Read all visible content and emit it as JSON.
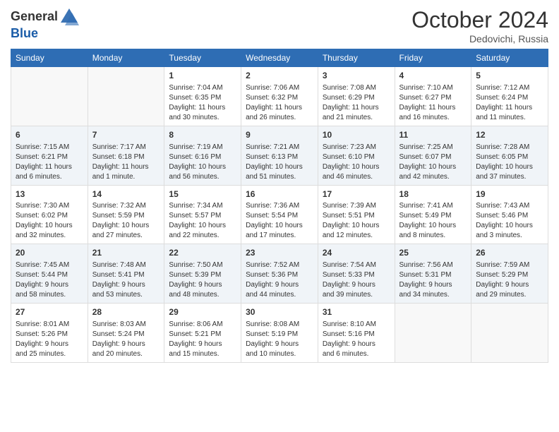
{
  "header": {
    "logo_general": "General",
    "logo_blue": "Blue",
    "month": "October 2024",
    "location": "Dedovichi, Russia"
  },
  "weekdays": [
    "Sunday",
    "Monday",
    "Tuesday",
    "Wednesday",
    "Thursday",
    "Friday",
    "Saturday"
  ],
  "weeks": [
    [
      {
        "day": "",
        "content": ""
      },
      {
        "day": "",
        "content": ""
      },
      {
        "day": "1",
        "content": "Sunrise: 7:04 AM\nSunset: 6:35 PM\nDaylight: 11 hours\nand 30 minutes."
      },
      {
        "day": "2",
        "content": "Sunrise: 7:06 AM\nSunset: 6:32 PM\nDaylight: 11 hours\nand 26 minutes."
      },
      {
        "day": "3",
        "content": "Sunrise: 7:08 AM\nSunset: 6:29 PM\nDaylight: 11 hours\nand 21 minutes."
      },
      {
        "day": "4",
        "content": "Sunrise: 7:10 AM\nSunset: 6:27 PM\nDaylight: 11 hours\nand 16 minutes."
      },
      {
        "day": "5",
        "content": "Sunrise: 7:12 AM\nSunset: 6:24 PM\nDaylight: 11 hours\nand 11 minutes."
      }
    ],
    [
      {
        "day": "6",
        "content": "Sunrise: 7:15 AM\nSunset: 6:21 PM\nDaylight: 11 hours\nand 6 minutes."
      },
      {
        "day": "7",
        "content": "Sunrise: 7:17 AM\nSunset: 6:18 PM\nDaylight: 11 hours\nand 1 minute."
      },
      {
        "day": "8",
        "content": "Sunrise: 7:19 AM\nSunset: 6:16 PM\nDaylight: 10 hours\nand 56 minutes."
      },
      {
        "day": "9",
        "content": "Sunrise: 7:21 AM\nSunset: 6:13 PM\nDaylight: 10 hours\nand 51 minutes."
      },
      {
        "day": "10",
        "content": "Sunrise: 7:23 AM\nSunset: 6:10 PM\nDaylight: 10 hours\nand 46 minutes."
      },
      {
        "day": "11",
        "content": "Sunrise: 7:25 AM\nSunset: 6:07 PM\nDaylight: 10 hours\nand 42 minutes."
      },
      {
        "day": "12",
        "content": "Sunrise: 7:28 AM\nSunset: 6:05 PM\nDaylight: 10 hours\nand 37 minutes."
      }
    ],
    [
      {
        "day": "13",
        "content": "Sunrise: 7:30 AM\nSunset: 6:02 PM\nDaylight: 10 hours\nand 32 minutes."
      },
      {
        "day": "14",
        "content": "Sunrise: 7:32 AM\nSunset: 5:59 PM\nDaylight: 10 hours\nand 27 minutes."
      },
      {
        "day": "15",
        "content": "Sunrise: 7:34 AM\nSunset: 5:57 PM\nDaylight: 10 hours\nand 22 minutes."
      },
      {
        "day": "16",
        "content": "Sunrise: 7:36 AM\nSunset: 5:54 PM\nDaylight: 10 hours\nand 17 minutes."
      },
      {
        "day": "17",
        "content": "Sunrise: 7:39 AM\nSunset: 5:51 PM\nDaylight: 10 hours\nand 12 minutes."
      },
      {
        "day": "18",
        "content": "Sunrise: 7:41 AM\nSunset: 5:49 PM\nDaylight: 10 hours\nand 8 minutes."
      },
      {
        "day": "19",
        "content": "Sunrise: 7:43 AM\nSunset: 5:46 PM\nDaylight: 10 hours\nand 3 minutes."
      }
    ],
    [
      {
        "day": "20",
        "content": "Sunrise: 7:45 AM\nSunset: 5:44 PM\nDaylight: 9 hours\nand 58 minutes."
      },
      {
        "day": "21",
        "content": "Sunrise: 7:48 AM\nSunset: 5:41 PM\nDaylight: 9 hours\nand 53 minutes."
      },
      {
        "day": "22",
        "content": "Sunrise: 7:50 AM\nSunset: 5:39 PM\nDaylight: 9 hours\nand 48 minutes."
      },
      {
        "day": "23",
        "content": "Sunrise: 7:52 AM\nSunset: 5:36 PM\nDaylight: 9 hours\nand 44 minutes."
      },
      {
        "day": "24",
        "content": "Sunrise: 7:54 AM\nSunset: 5:33 PM\nDaylight: 9 hours\nand 39 minutes."
      },
      {
        "day": "25",
        "content": "Sunrise: 7:56 AM\nSunset: 5:31 PM\nDaylight: 9 hours\nand 34 minutes."
      },
      {
        "day": "26",
        "content": "Sunrise: 7:59 AM\nSunset: 5:29 PM\nDaylight: 9 hours\nand 29 minutes."
      }
    ],
    [
      {
        "day": "27",
        "content": "Sunrise: 8:01 AM\nSunset: 5:26 PM\nDaylight: 9 hours\nand 25 minutes."
      },
      {
        "day": "28",
        "content": "Sunrise: 8:03 AM\nSunset: 5:24 PM\nDaylight: 9 hours\nand 20 minutes."
      },
      {
        "day": "29",
        "content": "Sunrise: 8:06 AM\nSunset: 5:21 PM\nDaylight: 9 hours\nand 15 minutes."
      },
      {
        "day": "30",
        "content": "Sunrise: 8:08 AM\nSunset: 5:19 PM\nDaylight: 9 hours\nand 10 minutes."
      },
      {
        "day": "31",
        "content": "Sunrise: 8:10 AM\nSunset: 5:16 PM\nDaylight: 9 hours\nand 6 minutes."
      },
      {
        "day": "",
        "content": ""
      },
      {
        "day": "",
        "content": ""
      }
    ]
  ]
}
